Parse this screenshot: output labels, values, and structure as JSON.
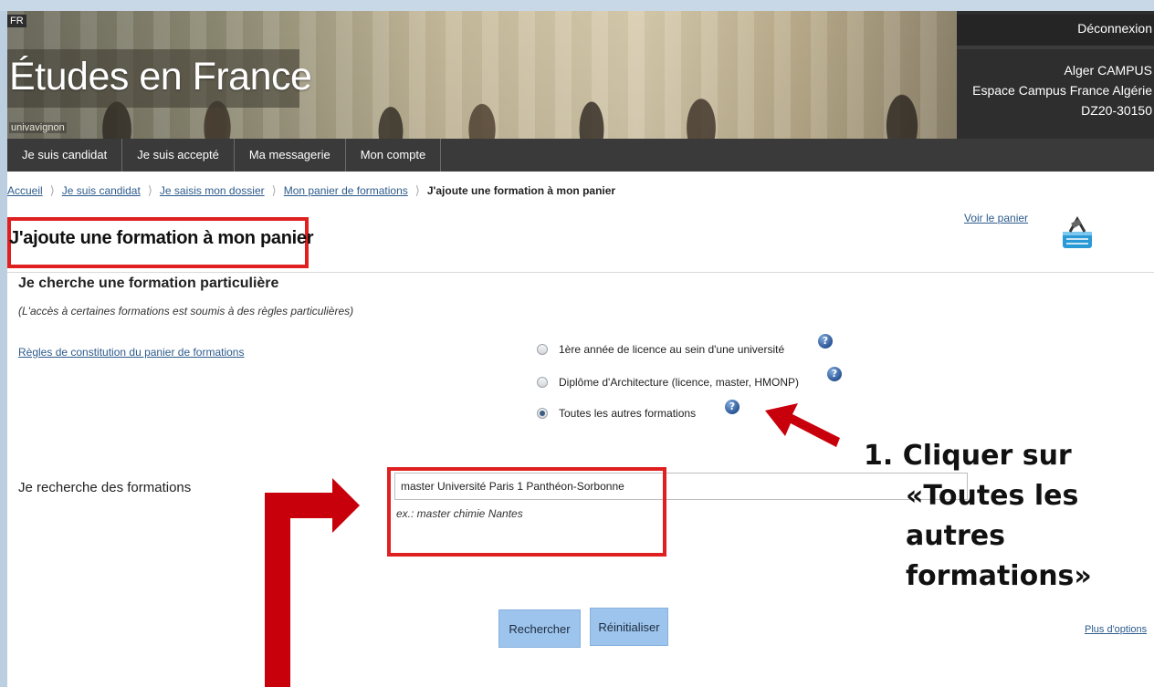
{
  "header": {
    "lang": "FR",
    "brand": "Études en France",
    "univ": "univavignon",
    "logout_label": "Déconnexion",
    "user_lines": [
      "Alger CAMPUS",
      "Espace Campus France Algérie",
      "DZ20-30150"
    ]
  },
  "nav": {
    "items": [
      "Je suis candidat",
      "Je suis accepté",
      "Ma messagerie",
      "Mon compte"
    ]
  },
  "breadcrumb": {
    "items": [
      "Accueil",
      "Je suis candidat",
      "Je saisis mon dossier",
      "Mon panier de formations"
    ],
    "current": "J'ajoute une formation à mon panier"
  },
  "page": {
    "title": "J'ajoute une formation à mon panier",
    "voir_panier": "Voir le panier",
    "section_heading": "Je cherche une formation particulière",
    "note": "(L'accès à certaines formations est soumis à des règles particulières)",
    "rules_link": "Règles de constitution du panier de formations"
  },
  "options": [
    {
      "label": "1ère année de licence au sein d'une université",
      "checked": false
    },
    {
      "label": "Diplôme d'Architecture (licence, master, HMONP)",
      "checked": false
    },
    {
      "label": "Toutes les autres formations",
      "checked": true
    }
  ],
  "search": {
    "label": "Je recherche des formations",
    "value": "master Université Paris 1 Panthéon-Sorbonne",
    "example": "ex.: master chimie Nantes",
    "submit_label": "Rechercher",
    "reset_label": "Réinitialiser",
    "more_options": "Plus d'options"
  },
  "annotation": {
    "line1": "1. Cliquer sur",
    "line2": "«Toutes les",
    "line3": "autres",
    "line4": "formations»"
  },
  "colors": {
    "accent_red": "#e02020",
    "arrow_red": "#c8000b",
    "link": "#2d5b8c",
    "button": "#9dc4ec",
    "nav": "#3a3a3a"
  }
}
